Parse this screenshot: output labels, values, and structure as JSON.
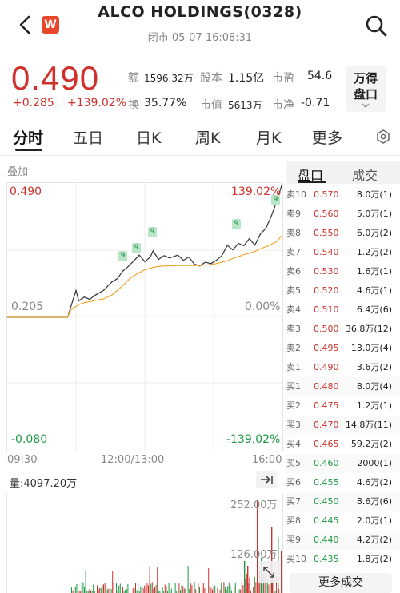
{
  "header": {
    "title": "ALCO HOLDINGS(0328)",
    "subtitle": "闭市 05-07 16:08:31",
    "logo": "W"
  },
  "quote": {
    "price": "0.490",
    "change": "+0.285",
    "change_pct": "+139.02%",
    "stats": [
      {
        "label": "额",
        "value": "1596.32万"
      },
      {
        "label": "股本",
        "value": "1.15亿"
      },
      {
        "label": "市盈",
        "value": "54.6"
      },
      {
        "label": "换",
        "value": "35.77%"
      },
      {
        "label": "市值",
        "value": "5613万"
      },
      {
        "label": "市净",
        "value": "-0.71"
      }
    ],
    "wd_line1": "万得",
    "wd_line2": "盘口"
  },
  "tabs": [
    "分时",
    "五日",
    "日K",
    "周K",
    "月K",
    "更多"
  ],
  "chart": {
    "overlay_label": "叠加",
    "price_high": "0.490",
    "pct_high": "139.02%",
    "price_mid": "0.205",
    "pct_mid": "0.00%",
    "price_low": "-0.080",
    "pct_low": "-139.02%",
    "time_start": "09:30",
    "time_mid": "12:00/13:00",
    "time_end": "16:00",
    "volume_label": "量:4097.20万",
    "vol_max": "252.00万",
    "vol_mid": "126.00万"
  },
  "chart_data": {
    "type": "line",
    "ylim": [
      -0.08,
      0.49
    ],
    "x": [
      0.0,
      0.05,
      0.12,
      0.18,
      0.22,
      0.23,
      0.25,
      0.26,
      0.28,
      0.3,
      0.32,
      0.35,
      0.38,
      0.4,
      0.42,
      0.44,
      0.46,
      0.48,
      0.5,
      0.52,
      0.53,
      0.55,
      0.57,
      0.59,
      0.62,
      0.64,
      0.66,
      0.68,
      0.7,
      0.72,
      0.74,
      0.76,
      0.78,
      0.8,
      0.82,
      0.84,
      0.86,
      0.88,
      0.9,
      0.92,
      0.94,
      0.96,
      0.98,
      1.0
    ],
    "series": [
      {
        "values": [
          0.205,
          0.205,
          0.205,
          0.205,
          0.205,
          0.225,
          0.262,
          0.24,
          0.248,
          0.243,
          0.252,
          0.262,
          0.28,
          0.287,
          0.303,
          0.313,
          0.325,
          0.337,
          0.323,
          0.333,
          0.346,
          0.328,
          0.336,
          0.331,
          0.337,
          0.326,
          0.333,
          0.318,
          0.314,
          0.322,
          0.319,
          0.326,
          0.336,
          0.358,
          0.348,
          0.362,
          0.357,
          0.372,
          0.358,
          0.382,
          0.394,
          0.42,
          0.452,
          0.49
        ]
      },
      {
        "values": [
          0.205,
          0.205,
          0.205,
          0.205,
          0.205,
          0.22,
          0.228,
          0.232,
          0.236,
          0.238,
          0.241,
          0.244,
          0.252,
          0.262,
          0.272,
          0.284,
          0.293,
          0.3,
          0.306,
          0.309,
          0.311,
          0.313,
          0.314,
          0.314,
          0.315,
          0.315,
          0.315,
          0.315,
          0.315,
          0.316,
          0.317,
          0.319,
          0.322,
          0.325,
          0.33,
          0.334,
          0.338,
          0.341,
          0.345,
          0.35,
          0.355,
          0.36,
          0.366,
          0.38
        ]
      }
    ]
  },
  "orderbook": {
    "tab_active": "盘口",
    "tab_other": "成交",
    "rows": [
      {
        "label": "卖10",
        "price": "0.570",
        "vol": "8.0万(1)"
      },
      {
        "label": "卖9",
        "price": "0.560",
        "vol": "5.0万(1)"
      },
      {
        "label": "卖8",
        "price": "0.550",
        "vol": "6.0万(2)"
      },
      {
        "label": "卖7",
        "price": "0.540",
        "vol": "1.2万(2)"
      },
      {
        "label": "卖6",
        "price": "0.530",
        "vol": "1.6万(1)"
      },
      {
        "label": "卖5",
        "price": "0.520",
        "vol": "4.6万(1)"
      },
      {
        "label": "卖4",
        "price": "0.510",
        "vol": "6.4万(6)"
      },
      {
        "label": "卖3",
        "price": "0.500",
        "vol": "36.8万(12)"
      },
      {
        "label": "卖2",
        "price": "0.495",
        "vol": "13.0万(4)"
      },
      {
        "label": "卖1",
        "price": "0.490",
        "vol": "3.6万(2)"
      },
      {
        "label": "买1",
        "price": "0.480",
        "vol": "8.0万(4)"
      },
      {
        "label": "买2",
        "price": "0.475",
        "vol": "1.2万(1)"
      },
      {
        "label": "买3",
        "price": "0.470",
        "vol": "14.8万(11)"
      },
      {
        "label": "买4",
        "price": "0.465",
        "vol": "59.2万(2)"
      },
      {
        "label": "买5",
        "price": "0.460",
        "vol": "2000(1)"
      },
      {
        "label": "买6",
        "price": "0.455",
        "vol": "4.6万(2)"
      },
      {
        "label": "买7",
        "price": "0.450",
        "vol": "8.6万(6)"
      },
      {
        "label": "买8",
        "price": "0.445",
        "vol": "2.0万(1)"
      },
      {
        "label": "买9",
        "price": "0.440",
        "vol": "4.2万(2)"
      },
      {
        "label": "买10",
        "price": "0.435",
        "vol": "1.8万(2)"
      }
    ],
    "more_label": "更多成交"
  },
  "colors": {
    "up": "#d0312d",
    "down": "#1f9a46",
    "avg": "#f0a020",
    "price_line": "#333333"
  }
}
